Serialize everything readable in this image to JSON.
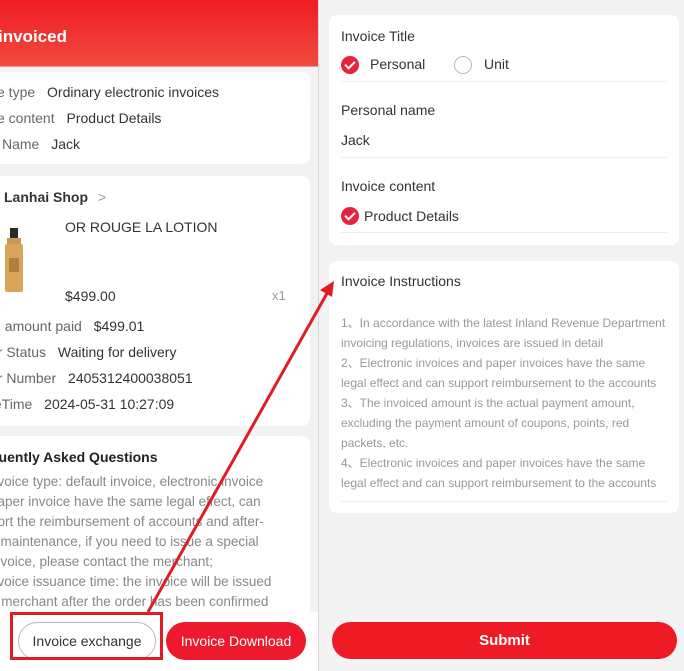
{
  "left": {
    "status": "invoiced",
    "invoice_info": {
      "type_key": "ce type",
      "type_val": "Ordinary electronic invoices",
      "content_key": "ce content",
      "content_val": "Product Details",
      "name_key": "Name",
      "name_val": "Jack"
    },
    "order": {
      "shop": "Lanhai Shop",
      "chevron": ">",
      "product_name": "OR ROUGE LA LOTION",
      "price": "$499.00",
      "qty": "x1",
      "paid_key": "al amount paid",
      "paid_val": "$499.01",
      "status_key": "er Status",
      "status_val": "Waiting for delivery",
      "number_key": "er Number",
      "number_val": "2405312400038051",
      "time_key": "teTime",
      "time_val": "2024-05-31 10:27:09"
    },
    "faq": {
      "title": "quently Asked Questions",
      "lines": [
        "nvoice type: default invoice, electronic invoice",
        "paper invoice have the same legal effect, can",
        "port the reimbursement of accounts and after-",
        "s maintenance, if you need to issue a special",
        "invoice, please contact the merchant;",
        "nvoice issuance time: the invoice will be issued",
        "e merchant after the order has been confirmed"
      ]
    },
    "buttons": {
      "exchange": "Invoice exchange",
      "download": "Invoice Download"
    }
  },
  "right": {
    "invoice_title_label": "Invoice Title",
    "personal": "Personal",
    "unit": "Unit",
    "personal_name_label": "Personal name",
    "personal_name_value": "Jack",
    "content_label": "Invoice content",
    "content_value": "Product Details",
    "instructions_title": "Invoice Instructions",
    "instructions": [
      "1、In accordance with the latest Inland Revenue Department",
      "invoicing regulations, invoices are issued in detail",
      "2、Electronic invoices and paper invoices have the same",
      "legal effect and can support reimbursement to the accounts",
      "3、The invoiced amount is the actual payment amount,",
      "excluding the payment amount of coupons, points, red",
      "packets, etc.",
      "4、Electronic invoices and paper invoices have the same",
      "legal effect and can support reimbursement to the accounts"
    ],
    "submit": "Submit"
  },
  "colors": {
    "accent": "#ec1a2c",
    "annotation": "#e01c24"
  }
}
